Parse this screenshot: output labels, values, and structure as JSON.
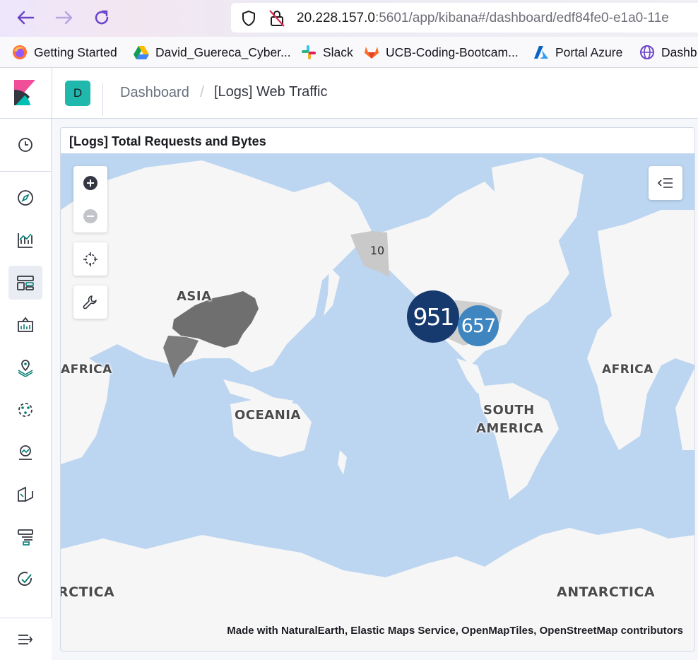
{
  "browser": {
    "url_host": "20.228.157.0",
    "url_rest": ":5601/app/kibana#/dashboard/edf84fe0-e1a0-11e",
    "bookmarks": [
      {
        "label": "Getting Started",
        "icon": "firefox-icon"
      },
      {
        "label": "David_Guereca_Cyber...",
        "icon": "google-drive-icon"
      },
      {
        "label": "Slack",
        "icon": "slack-icon"
      },
      {
        "label": "UCB-Coding-Bootcam...",
        "icon": "gitlab-icon"
      },
      {
        "label": "Portal Azure",
        "icon": "azure-icon"
      },
      {
        "label": "Dashb",
        "icon": "globe-icon"
      }
    ]
  },
  "header": {
    "space_initial": "D",
    "breadcrumb_root": "Dashboard",
    "breadcrumb_separator": "/",
    "breadcrumb_current": "[Logs] Web Traffic"
  },
  "panel": {
    "title": "[Logs] Total Requests and Bytes"
  },
  "map": {
    "clusters": [
      {
        "count": "951",
        "color": "#173a6e"
      },
      {
        "count": "657",
        "color": "#3f86c1"
      },
      {
        "count": "10",
        "color": "#cacaca"
      }
    ],
    "labels": {
      "asia": "ASIA",
      "africa_left": "AFRICA",
      "africa_right": "AFRICA",
      "oceania": "OCEANIA",
      "south_america_line1": "SOUTH",
      "south_america_line2": "AMERICA",
      "antarctica_left": "RCTICA",
      "antarctica_right": "ANTARCTICA"
    },
    "attribution": "Made with NaturalEarth, Elastic Maps Service, OpenMapTiles, OpenStreetMap contributors"
  },
  "colors": {
    "ocean": "#bcd5f0",
    "land": "#f6f6f6",
    "choropleth_dark": "#6f6f6f",
    "choropleth_light": "#c9c9c9",
    "kibana_teal": "#20b7ac"
  }
}
